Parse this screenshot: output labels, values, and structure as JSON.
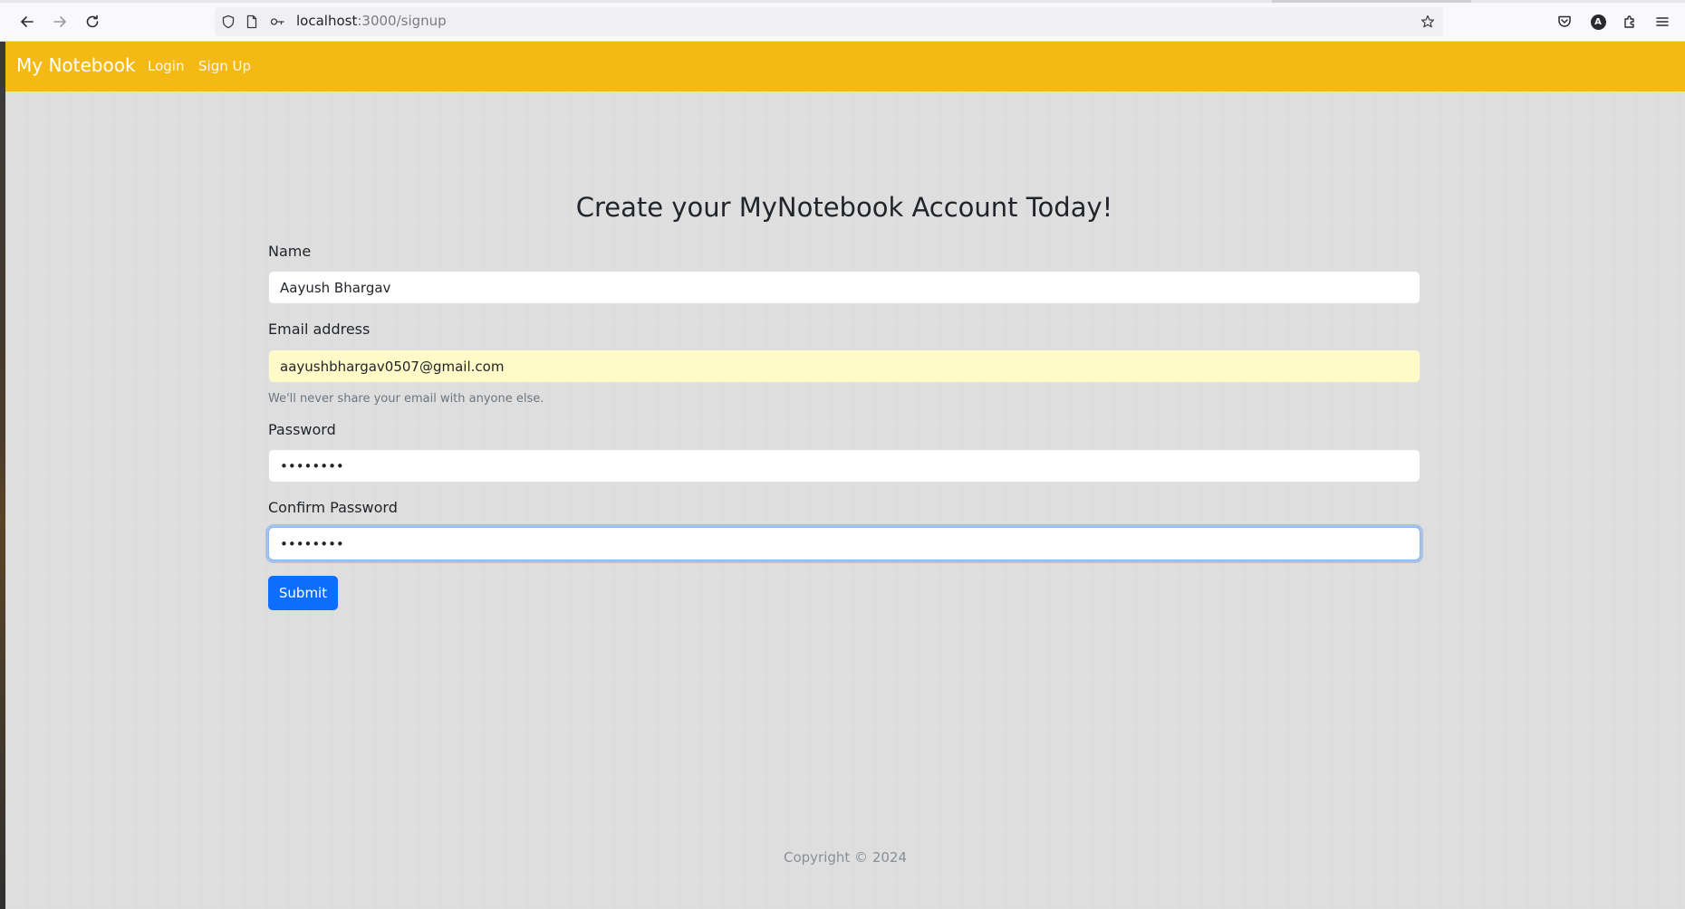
{
  "browser": {
    "url_host": "localhost",
    "url_path": ":3000/signup",
    "icons": {
      "back": "arrow-left-icon",
      "forward": "arrow-right-icon",
      "reload": "reload-icon",
      "shield": "shield-icon",
      "page": "page-icon",
      "permissions": "key-icon",
      "bookmark": "star-icon",
      "pocket": "pocket-icon",
      "account": "account-icon",
      "extensions": "puzzle-icon",
      "menu": "hamburger-menu-icon"
    },
    "account_initial": "A"
  },
  "navbar": {
    "brand": "My Notebook",
    "links": [
      "Login",
      "Sign Up"
    ],
    "background": "#f5b914"
  },
  "form": {
    "title": "Create your MyNotebook Account Today!",
    "name_label": "Name",
    "name_value": "Aayush Bhargav",
    "email_label": "Email address",
    "email_value": "aayushbhargav0507@gmail.com",
    "email_help": "We'll never share your email with anyone else.",
    "password_label": "Password",
    "password_value": "password",
    "confirm_label": "Confirm Password",
    "confirm_value": "password",
    "submit_label": "Submit",
    "submit_color": "#0d6efd"
  },
  "footer": {
    "copyright": "Copyright © 2024"
  }
}
